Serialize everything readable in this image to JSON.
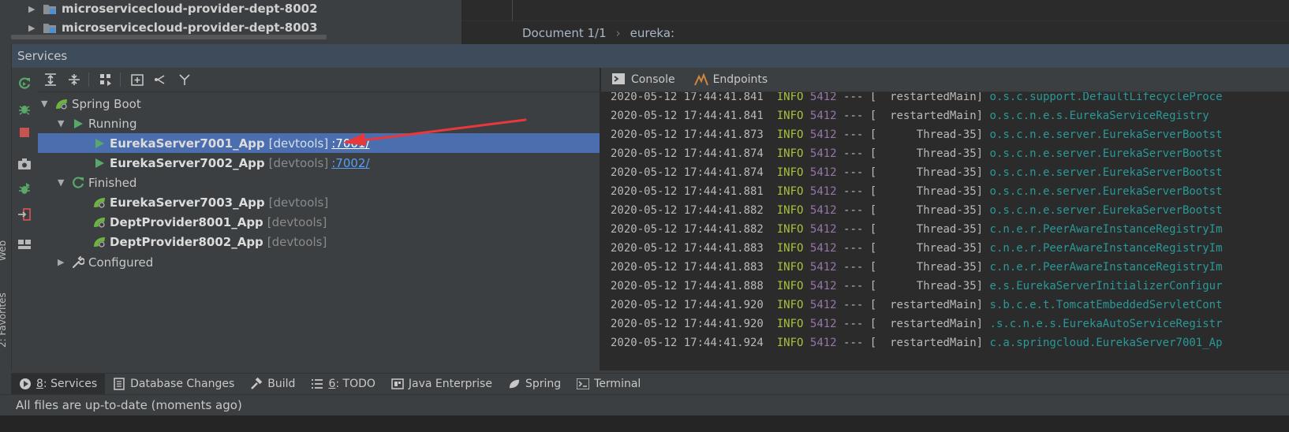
{
  "project_tree": {
    "items": [
      {
        "label": "microservicecloud-provider-dept-8002"
      },
      {
        "label": "microservicecloud-provider-dept-8003"
      }
    ]
  },
  "editor": {
    "breadcrumb": [
      "Document 1/1",
      "eureka:"
    ]
  },
  "services_panel": {
    "title": "Services",
    "toolbar": [
      "expand-all",
      "collapse-all",
      "group-by",
      "new-service",
      "branch",
      "merge"
    ],
    "tree": {
      "root": "Spring Boot",
      "groups": [
        {
          "label": "Running",
          "items": [
            {
              "name": "EurekaServer7001_App",
              "tag": "[devtools]",
              "port": ":7001/",
              "selected": true
            },
            {
              "name": "EurekaServer7002_App",
              "tag": "[devtools]",
              "port": ":7002/",
              "selected": false
            }
          ]
        },
        {
          "label": "Finished",
          "items": [
            {
              "name": "EurekaServer7003_App",
              "tag": "[devtools]"
            },
            {
              "name": "DeptProvider8001_App",
              "tag": "[devtools]"
            },
            {
              "name": "DeptProvider8002_App",
              "tag": "[devtools]"
            }
          ]
        },
        {
          "label": "Configured",
          "items": []
        }
      ]
    }
  },
  "console": {
    "tabs": [
      "Console",
      "Endpoints"
    ],
    "lines": [
      {
        "ts": "2020-05-12 17:44:41.841",
        "level": "INFO",
        "pid": "5412",
        "sep": "--- [",
        "thread": " restartedMain]",
        "logger": "o.s.c.support.DefaultLifecycleProce"
      },
      {
        "ts": "2020-05-12 17:44:41.841",
        "level": "INFO",
        "pid": "5412",
        "sep": "--- [",
        "thread": " restartedMain]",
        "logger": "o.s.c.n.e.s.EurekaServiceRegistry"
      },
      {
        "ts": "2020-05-12 17:44:41.873",
        "level": "INFO",
        "pid": "5412",
        "sep": "--- [",
        "thread": "     Thread-35]",
        "logger": "o.s.c.n.e.server.EurekaServerBootst"
      },
      {
        "ts": "2020-05-12 17:44:41.874",
        "level": "INFO",
        "pid": "5412",
        "sep": "--- [",
        "thread": "     Thread-35]",
        "logger": "o.s.c.n.e.server.EurekaServerBootst"
      },
      {
        "ts": "2020-05-12 17:44:41.874",
        "level": "INFO",
        "pid": "5412",
        "sep": "--- [",
        "thread": "     Thread-35]",
        "logger": "o.s.c.n.e.server.EurekaServerBootst"
      },
      {
        "ts": "2020-05-12 17:44:41.881",
        "level": "INFO",
        "pid": "5412",
        "sep": "--- [",
        "thread": "     Thread-35]",
        "logger": "o.s.c.n.e.server.EurekaServerBootst"
      },
      {
        "ts": "2020-05-12 17:44:41.882",
        "level": "INFO",
        "pid": "5412",
        "sep": "--- [",
        "thread": "     Thread-35]",
        "logger": "o.s.c.n.e.server.EurekaServerBootst"
      },
      {
        "ts": "2020-05-12 17:44:41.882",
        "level": "INFO",
        "pid": "5412",
        "sep": "--- [",
        "thread": "     Thread-35]",
        "logger": "c.n.e.r.PeerAwareInstanceRegistryIm"
      },
      {
        "ts": "2020-05-12 17:44:41.883",
        "level": "INFO",
        "pid": "5412",
        "sep": "--- [",
        "thread": "     Thread-35]",
        "logger": "c.n.e.r.PeerAwareInstanceRegistryIm"
      },
      {
        "ts": "2020-05-12 17:44:41.883",
        "level": "INFO",
        "pid": "5412",
        "sep": "--- [",
        "thread": "     Thread-35]",
        "logger": "c.n.e.r.PeerAwareInstanceRegistryIm"
      },
      {
        "ts": "2020-05-12 17:44:41.888",
        "level": "INFO",
        "pid": "5412",
        "sep": "--- [",
        "thread": "     Thread-35]",
        "logger": "e.s.EurekaServerInitializerConfigur"
      },
      {
        "ts": "2020-05-12 17:44:41.920",
        "level": "INFO",
        "pid": "5412",
        "sep": "--- [",
        "thread": " restartedMain]",
        "logger": "s.b.c.e.t.TomcatEmbeddedServletCont"
      },
      {
        "ts": "2020-05-12 17:44:41.920",
        "level": "INFO",
        "pid": "5412",
        "sep": "--- [",
        "thread": " restartedMain]",
        "logger": ".s.c.n.e.s.EurekaAutoServiceRegistr"
      },
      {
        "ts": "2020-05-12 17:44:41.924",
        "level": "INFO",
        "pid": "5412",
        "sep": "--- [",
        "thread": " restartedMain]",
        "logger": "c.a.springcloud.EurekaServer7001_Ap"
      }
    ]
  },
  "side_stripe": {
    "web": "Web",
    "favorites": "2: Favorites"
  },
  "bottom_tools": [
    {
      "prefix": "8",
      "label": ": Services",
      "active": true
    },
    {
      "prefix": "",
      "label": "Database Changes"
    },
    {
      "prefix": "",
      "label": "Build"
    },
    {
      "prefix": "6",
      "label": ": TODO"
    },
    {
      "prefix": "",
      "label": "Java Enterprise"
    },
    {
      "prefix": "",
      "label": "Spring"
    },
    {
      "prefix": "",
      "label": "Terminal"
    }
  ],
  "status": {
    "text": "All files are up-to-date (moments ago)"
  },
  "colors": {
    "accent_selection": "#4b6eaf",
    "annotation_arrow": "#e8383a",
    "run_green": "#59a869"
  }
}
